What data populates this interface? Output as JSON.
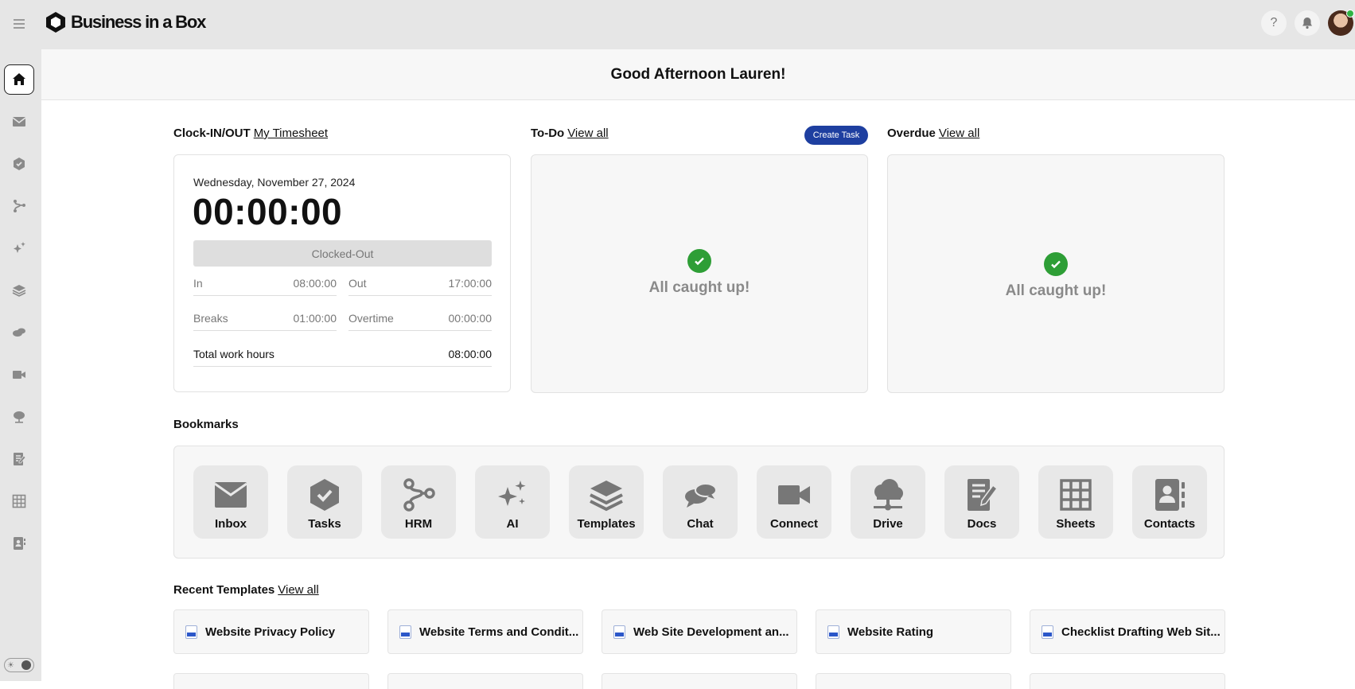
{
  "app": {
    "name": "Business in a Box"
  },
  "topbar": {
    "help_icon": "question-icon",
    "notifications_icon": "bell-icon",
    "avatar_alt": "user-avatar"
  },
  "theme_toggle": {
    "sun": "☀"
  },
  "greeting": "Good Afternoon Lauren!",
  "clock": {
    "title": "Clock-IN/OUT",
    "link": "My Timesheet",
    "date": "Wednesday, November 27, 2024",
    "time": "00:00:00",
    "status": "Clocked-Out",
    "in_label": "In",
    "in_value": "08:00:00",
    "out_label": "Out",
    "out_value": "17:00:00",
    "breaks_label": "Breaks",
    "breaks_value": "01:00:00",
    "overtime_label": "Overtime",
    "overtime_value": "00:00:00",
    "total_label": "Total work hours",
    "total_value": "08:00:00"
  },
  "todo": {
    "title": "To-Do",
    "link": "View all",
    "create_label": "Create Task",
    "empty": "All caught up!"
  },
  "overdue": {
    "title": "Overdue",
    "link": "View all",
    "empty": "All caught up!"
  },
  "bookmarks": {
    "title": "Bookmarks",
    "items": [
      {
        "label": "Inbox",
        "icon": "envelope-icon"
      },
      {
        "label": "Tasks",
        "icon": "task-shield-icon"
      },
      {
        "label": "HRM",
        "icon": "hrm-icon"
      },
      {
        "label": "AI",
        "icon": "sparkles-icon"
      },
      {
        "label": "Templates",
        "icon": "layers-icon"
      },
      {
        "label": "Chat",
        "icon": "chat-icon"
      },
      {
        "label": "Connect",
        "icon": "video-icon"
      },
      {
        "label": "Drive",
        "icon": "cloud-icon"
      },
      {
        "label": "Docs",
        "icon": "docs-icon"
      },
      {
        "label": "Sheets",
        "icon": "grid-icon"
      },
      {
        "label": "Contacts",
        "icon": "contacts-icon"
      }
    ]
  },
  "recent_templates": {
    "title": "Recent Templates",
    "link": "View all",
    "items": [
      {
        "name": "Website Privacy Policy"
      },
      {
        "name": "Website Terms and Condit..."
      },
      {
        "name": "Web Site Development an..."
      },
      {
        "name": "Website Rating"
      },
      {
        "name": "Checklist Drafting Web Sit..."
      }
    ]
  },
  "sidebar": {
    "items": [
      "home-icon",
      "envelope-icon",
      "task-shield-icon",
      "hrm-icon",
      "sparkles-icon",
      "layers-icon",
      "chat-icon",
      "video-icon",
      "cloud-icon",
      "docs-icon",
      "grid-icon",
      "contacts-icon"
    ]
  },
  "colors": {
    "accent": "#1e3fa0",
    "success": "#2e9e36",
    "bg_bar": "#e6e6e6"
  }
}
